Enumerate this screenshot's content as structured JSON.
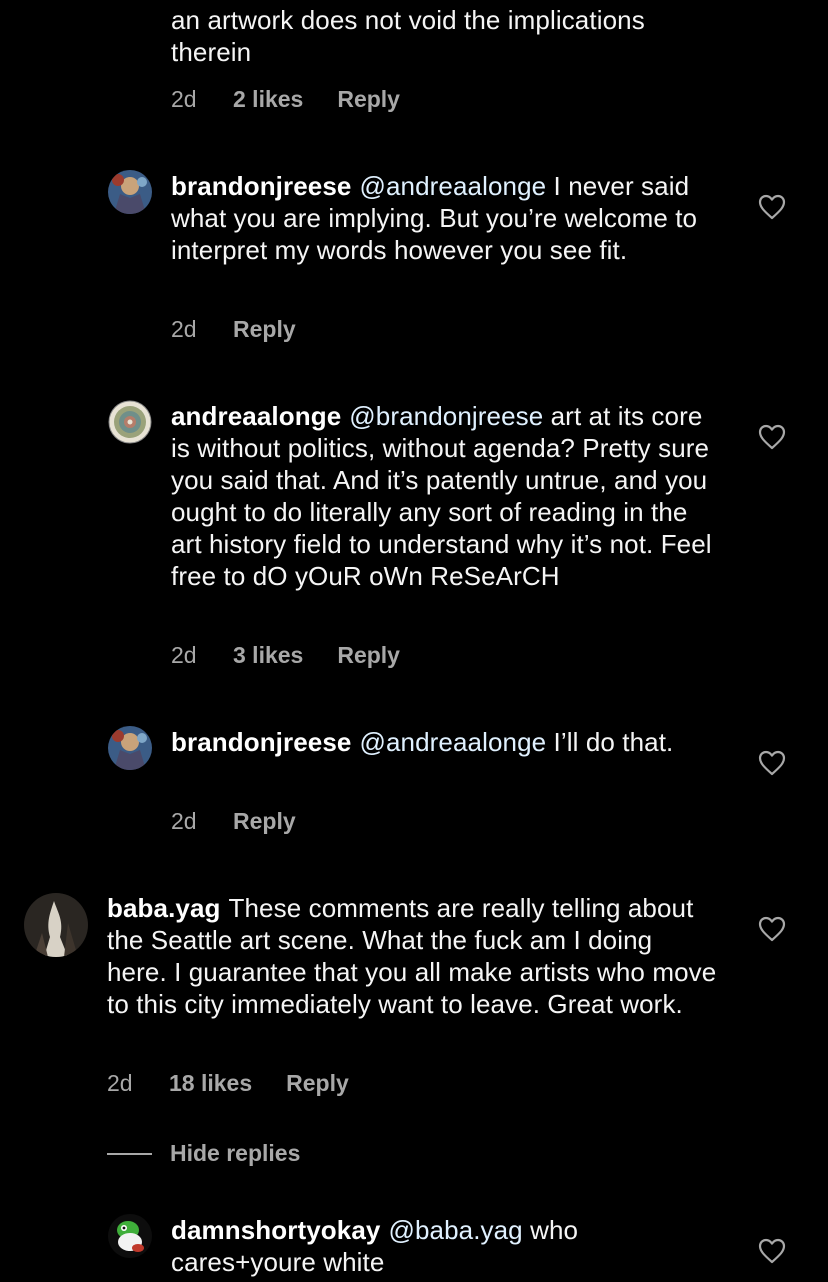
{
  "comments": [
    {
      "body_tail_line1": "an artwork does not void the implications",
      "body_tail_line2": "therein",
      "time": "2d",
      "likes": "2 likes",
      "reply": "Reply"
    },
    {
      "username": "brandonjreese",
      "mention": "@andreaalonge",
      "text": " I never said what you are implying. But you’re welcome to interpret my words however you see fit.",
      "time": "2d",
      "reply": "Reply"
    },
    {
      "username": "andreaalonge",
      "mention": "@brandonjreese",
      "text": " art at its core is without politics, without agenda? Pretty sure you said that. And it’s patently untrue, and you ought to do literally any sort of reading in the art history field to understand why it’s not. Feel free to dO yOuR oWn ReSeArCH",
      "time": "2d",
      "likes": "3 likes",
      "reply": "Reply"
    },
    {
      "username": "brandonjreese",
      "mention": "@andreaalonge",
      "text": " I’ll do that.",
      "time": "2d",
      "reply": "Reply"
    },
    {
      "username": "baba.yag",
      "text": "These comments are really telling about the Seattle art scene. What the fuck am I doing here. I guarantee that you all make artists who move to this city immediately want to leave. Great work.",
      "time": "2d",
      "likes": "18 likes",
      "reply": "Reply"
    },
    {
      "username": "damnshortyokay",
      "mention": "@baba.yag",
      "text": " who cares+youre white"
    }
  ],
  "hide_replies": "Hide replies",
  "colors": {
    "background": "#000000",
    "text": "#f5f5f5",
    "secondary": "#a8a8a8",
    "mention": "#e0f1ff"
  },
  "icons": {
    "like": "heart-outline-icon"
  }
}
